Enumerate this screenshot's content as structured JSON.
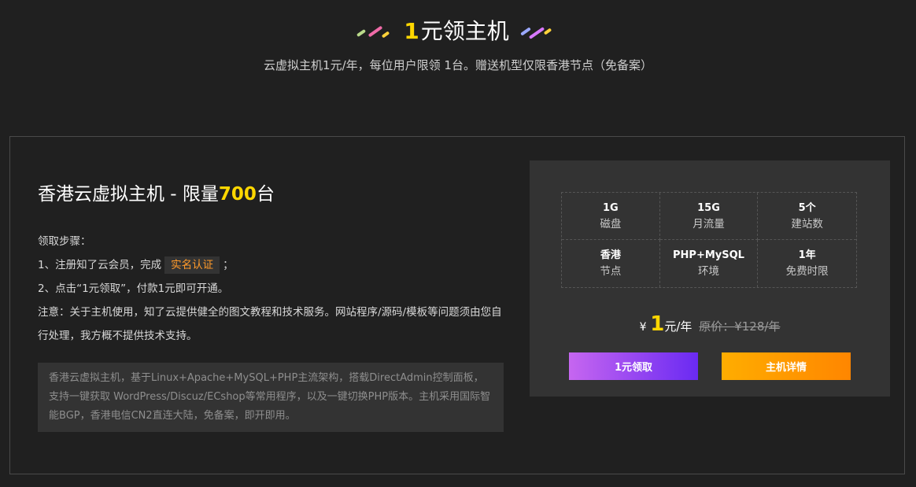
{
  "header": {
    "title_number": "1",
    "title_text": "元领主机",
    "subtitle": "云虚拟主机1元/年，每位用户限领 1台。赠送机型仅限香港节点（免备案）"
  },
  "product": {
    "title_prefix": "香港云虚拟主机 - 限量",
    "title_highlight": "700",
    "title_suffix": "台"
  },
  "steps": {
    "heading": "领取步骤：",
    "step1_before": "1、注册知了云会员，完成",
    "step1_badge": "实名认证",
    "step1_after": "；",
    "step2": "2、点击“1元领取”，付款1元即可开通。",
    "note": "注意：关于主机使用，知了云提供健全的图文教程和技术服务。网站程序/源码/模板等问题须由您自行处理，我方概不提供技术支持。"
  },
  "description": "香港云虚拟主机，基于Linux+Apache+MySQL+PHP主流架构，搭载DirectAdmin控制面板，支持一键获取 WordPress/Discuz/ECshop等常用程序，以及一键切换PHP版本。主机采用国际智能BGP，香港电信CN2直连大陆，免备案，即开即用。",
  "specs": [
    {
      "value": "1G",
      "label": "磁盘"
    },
    {
      "value": "15G",
      "label": "月流量"
    },
    {
      "value": "5个",
      "label": "建站数"
    },
    {
      "value": "香港",
      "label": "节点"
    },
    {
      "value": "PHP+MySQL",
      "label": "环境"
    },
    {
      "value": "1年",
      "label": "免费时限"
    }
  ],
  "price": {
    "currency": "¥",
    "amount": "1",
    "unit": "元/年",
    "original": "原价：¥128/年"
  },
  "buttons": {
    "claim": "1元领取",
    "detail": "主机详情"
  },
  "colors": {
    "background": "#202020",
    "panel": "#333333",
    "highlight": "#ffd700",
    "badge_text": "#ff9a2a",
    "claim_gradient": [
      "#c666f0",
      "#6a2af2"
    ],
    "detail_gradient": [
      "#ffad00",
      "#ff8600"
    ]
  }
}
